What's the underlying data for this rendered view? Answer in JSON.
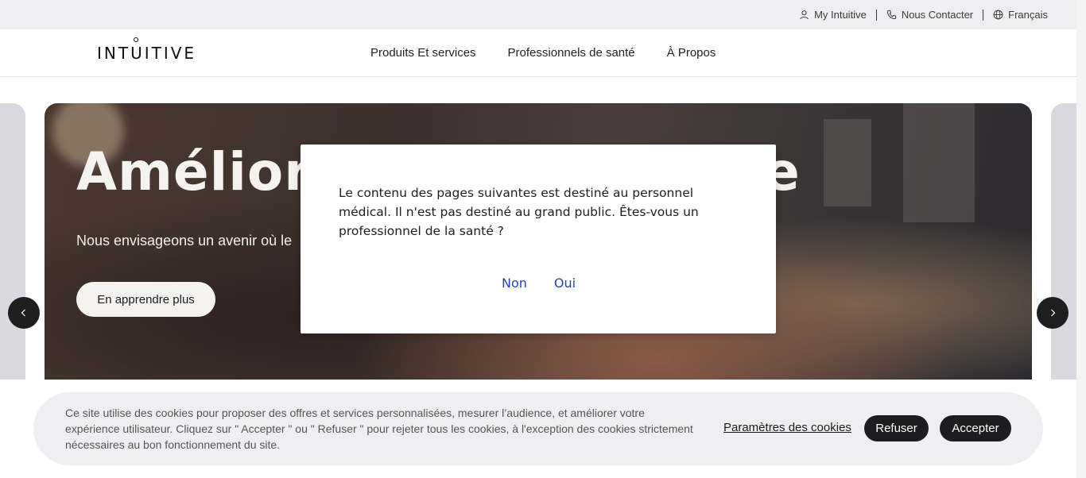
{
  "utility": {
    "my_intuitive": "My Intuitive",
    "contact": "Nous Contacter",
    "language": "Français"
  },
  "header": {
    "logo": "INTUITIVE",
    "nav": [
      "Produits Et services",
      "Professionnels de santé",
      "À Propos"
    ]
  },
  "hero": {
    "title_visible": "Améliore",
    "title_end": "e",
    "subtitle_visible": "Nous envisageons un avenir où le",
    "cta": "En apprendre plus"
  },
  "modal": {
    "text": "Le contenu des pages suivantes est destiné au personnel médical. Il n'est pas destiné au grand public. Êtes-vous un professionnel de la santé ?",
    "no": "Non",
    "yes": "Oui"
  },
  "cookies": {
    "text": "Ce site utilise des cookies pour proposer des offres et services personnalisées, mesurer l’audience, et améliorer votre expérience utilisateur. Cliquez sur \" Accepter \" ou \" Refuser \" pour rejeter tous les cookies, à l'exception des cookies strictement nécessaires au bon fonctionnement du site.",
    "settings": "Paramètres des cookies",
    "refuse": "Refuser",
    "accept": "Accepter"
  },
  "icons": {
    "user": "user-icon",
    "phone": "phone-icon",
    "globe": "globe-icon",
    "prev": "chevron-left-icon",
    "next": "chevron-right-icon"
  },
  "colors": {
    "link_blue": "#2a3dbd",
    "dark_button": "#1d1d1f",
    "banner_bg": "#efeff2"
  }
}
